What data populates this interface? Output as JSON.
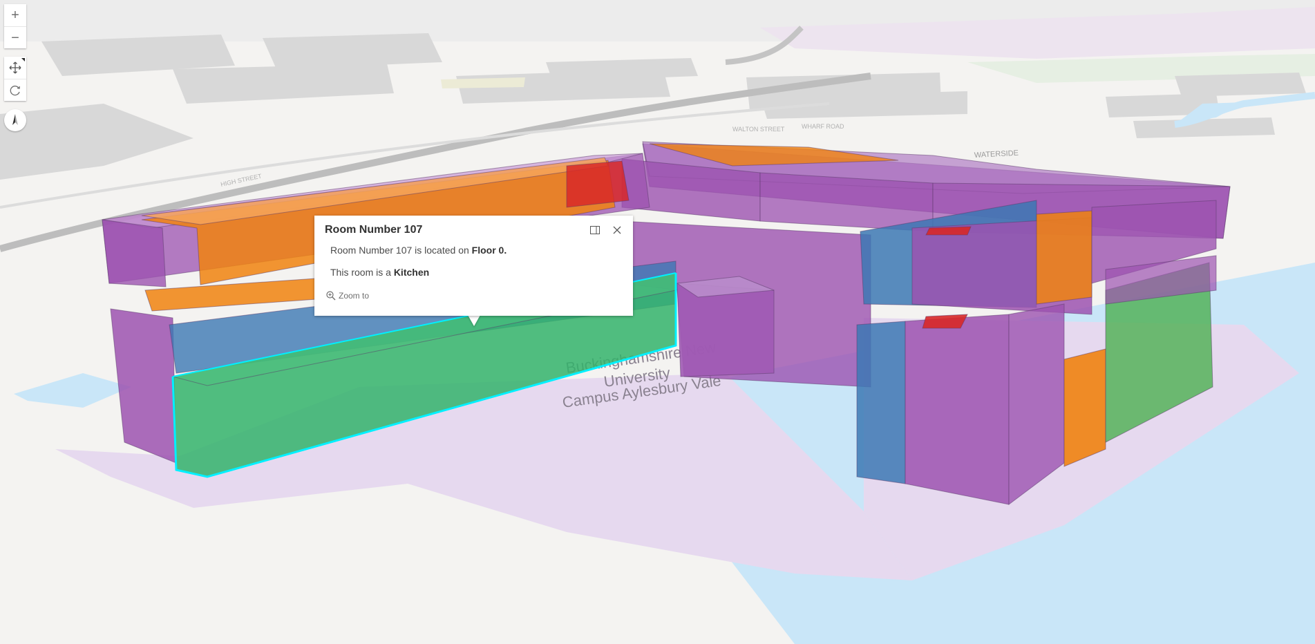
{
  "nav": {
    "zoom_in_glyph": "+",
    "zoom_out_glyph": "−",
    "pan_icon": "move-icon",
    "rotate_icon": "rotate-icon",
    "compass_icon": "compass-icon"
  },
  "map_labels": {
    "campus_line1": "Buckinghamshire New",
    "campus_line2": "University",
    "campus_line3": "Campus Aylesbury Vale",
    "street_waterside": "WATERSIDE",
    "street_top": "WHARF ROAD",
    "street_top2": "WALTON STREET",
    "street_left": "HIGH STREET"
  },
  "colors": {
    "kitchen": "#33b36b",
    "highlight": "#00ffff",
    "office": "#9c52b0",
    "lecture": "#f0820f",
    "toilet": "#d72828",
    "corridor": "#3c78b4",
    "water": "#c8e6f8",
    "campus": "#e6d8ee"
  },
  "popup": {
    "title": "Room Number 107",
    "line1_prefix": "Room Number 107 is located on ",
    "line1_value": "Floor 0.",
    "line2_prefix": "This room is a ",
    "line2_value": "Kitchen",
    "zoom_label": "Zoom to",
    "dock_icon": "dock-icon",
    "close_icon": "close-icon"
  }
}
